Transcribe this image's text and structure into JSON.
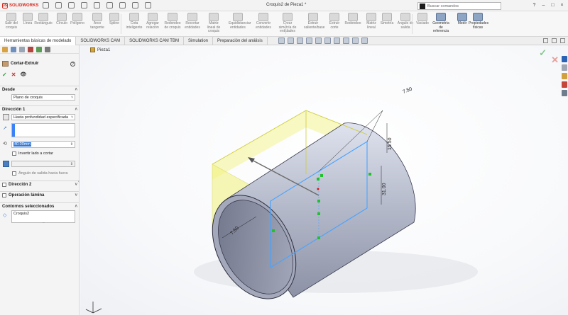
{
  "app": {
    "brand": "SOLIDWORKS",
    "doc_title": "Croquis2 de Pieza1 *",
    "search_placeholder": "Buscar comandos"
  },
  "ribbon": [
    {
      "label": "Salir del croquis"
    },
    {
      "label": "Línea"
    },
    {
      "label": "Rectángulo"
    },
    {
      "label": "Círculo"
    },
    {
      "label": "Polígono"
    },
    {
      "label": "Arco tangente"
    },
    {
      "label": "Spline"
    },
    {
      "label": "Cota inteligente"
    },
    {
      "label": "Agregar relación"
    },
    {
      "label": "Redondeo de croquis"
    },
    {
      "label": "Recortar entidades"
    },
    {
      "label": "Matriz lineal de croquis"
    },
    {
      "label": "Equidistanciar entidades"
    },
    {
      "label": "Convertir entidades"
    },
    {
      "label": "Crear simetría de entidades"
    },
    {
      "label": "Extruir saliente/base"
    },
    {
      "label": "Extruir corte"
    },
    {
      "label": "Redondeo"
    },
    {
      "label": "Matriz lineal"
    },
    {
      "label": "Simetría"
    },
    {
      "label": "Ángulo de salida"
    },
    {
      "label": "Vaciado"
    },
    {
      "label": "Geometría de referencia"
    },
    {
      "label": "Medir"
    },
    {
      "label": "Propiedades físicas"
    }
  ],
  "tabs": [
    "Herramientas básicas de modelado",
    "SOLIDWORKS CAM",
    "SOLIDWORKS CAM TBM",
    "Simulation",
    "Preparación del análisis"
  ],
  "panel": {
    "feature_name": "Cortar-Extruir",
    "desde": {
      "label": "Desde",
      "value": "Plano de croquis"
    },
    "direccion1": {
      "label": "Dirección 1",
      "end_condition": "Hasta profundidad especificada",
      "depth": "40.00mm",
      "invert_label": "Invertir lado a cortar",
      "draft_label": "Ángulo de salida hacia fuera"
    },
    "direccion2": {
      "label": "Dirección 2"
    },
    "operacion_lamina": {
      "label": "Operación lámina"
    },
    "contornos": {
      "label": "Contornos seleccionados",
      "item": "Croquis2"
    }
  },
  "viewport": {
    "breadcrumb": "Pieza1",
    "dimensions": {
      "d1": "7.50",
      "d2": "15.50",
      "d3": "31.00",
      "d4": "7.50"
    }
  },
  "colors": {
    "ok": "#2e9d3b",
    "cancel": "#c9302c",
    "accent": "#2f6fd0",
    "sketch_blue": "#4aa3ff",
    "preview_yellow": "#f2f27a"
  }
}
